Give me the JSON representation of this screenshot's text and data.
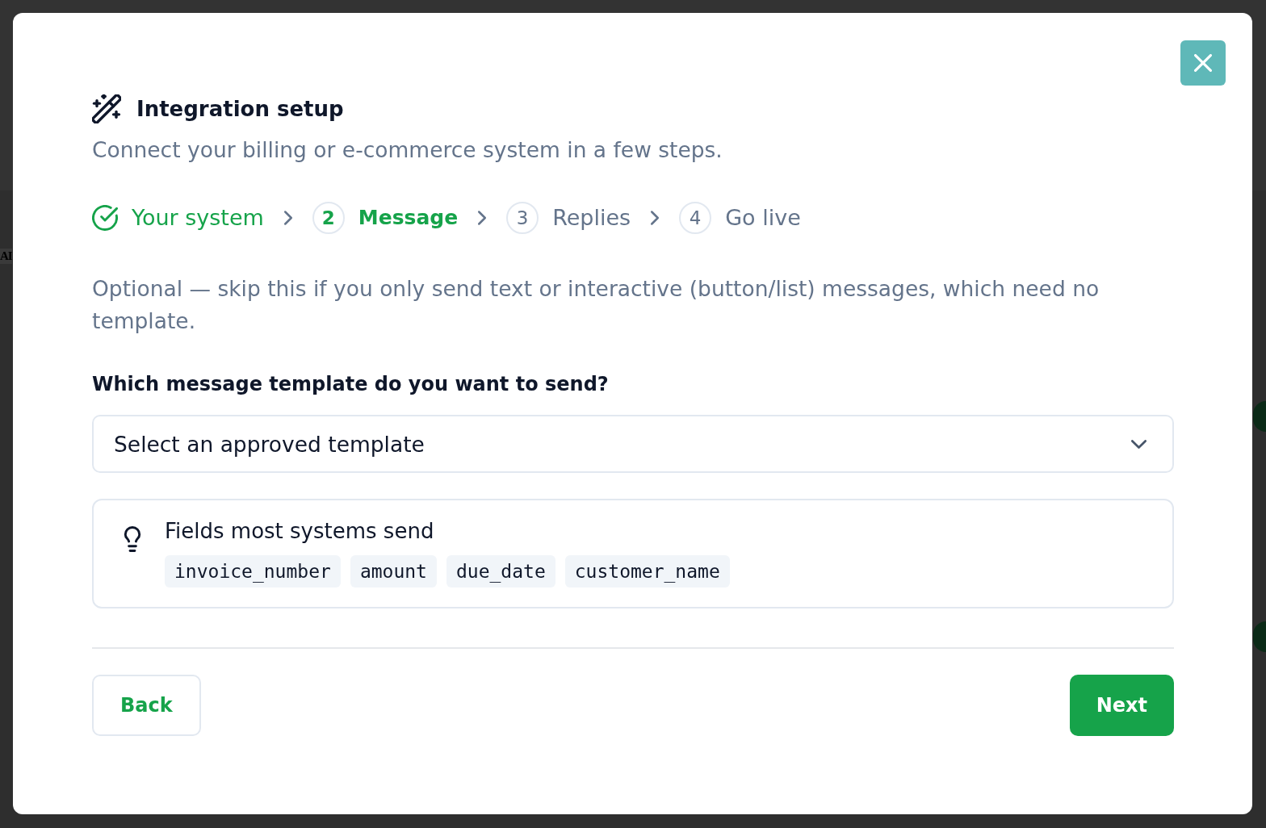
{
  "background": {
    "text": "AI"
  },
  "dialog": {
    "title": "Integration setup",
    "subtitle": "Connect your billing or e-commerce system in a few steps.",
    "steps": [
      {
        "label": "Your system",
        "kind": "done"
      },
      {
        "number": "2",
        "label": "Message",
        "kind": "current"
      },
      {
        "number": "3",
        "label": "Replies",
        "kind": "upcoming"
      },
      {
        "number": "4",
        "label": "Go live",
        "kind": "upcoming"
      }
    ],
    "note": "Optional — skip this if you only send text or interactive (button/list) messages, which need no template.",
    "question": "Which message template do you want to send?",
    "template_select": {
      "placeholder": "Select an approved template"
    },
    "hint": {
      "title": "Fields most systems send",
      "fields": [
        "invoice_number",
        "amount",
        "due_date",
        "customer_name"
      ]
    },
    "buttons": [
      {
        "label": "Back",
        "kind": "secondary"
      },
      {
        "label": "Next",
        "kind": "primary"
      }
    ]
  }
}
